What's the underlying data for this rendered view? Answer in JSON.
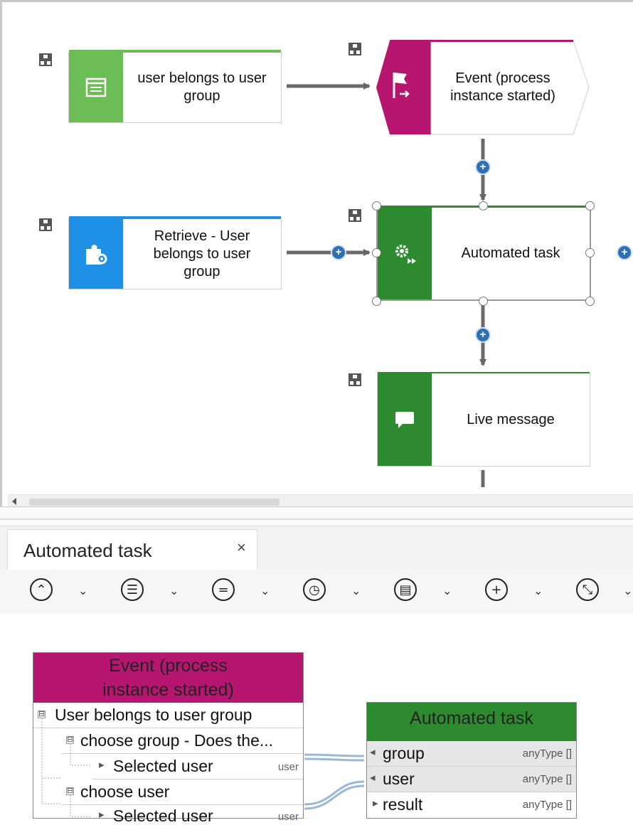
{
  "diagram": {
    "nodes": [
      {
        "id": "user-belongs",
        "label": "user belongs to user\ngroup",
        "band_color": "#6dbd57",
        "icon": "form-icon"
      },
      {
        "id": "event",
        "label": "Event (process\ninstance started)",
        "band_color": "#b6166f",
        "icon": "flag-event-icon"
      },
      {
        "id": "retrieve",
        "label": "Retrieve - User\nbelongs to user\ngroup",
        "band_color": "#1e90e6",
        "icon": "puzzle-gear-icon"
      },
      {
        "id": "automated",
        "label": "Automated task",
        "band_color": "#2e8a2e",
        "icon": "gear-play-icon"
      },
      {
        "id": "live",
        "label": "Live message",
        "band_color": "#2e8a2e",
        "icon": "speech-bubble-icon"
      }
    ],
    "plus_symbol": "+"
  },
  "panel": {
    "tab_title": "Automated task",
    "tab_close": "×",
    "toolbar": [
      {
        "icon": "caret-up-circle-icon",
        "glyph": "⌃"
      },
      {
        "icon": "list-circle-icon",
        "glyph": "☰"
      },
      {
        "icon": "equals-circle-icon",
        "glyph": "="
      },
      {
        "icon": "clock-circle-icon",
        "glyph": "◷"
      },
      {
        "icon": "document-circle-icon",
        "glyph": "▤"
      },
      {
        "icon": "crosshair-circle-icon",
        "glyph": "+"
      },
      {
        "icon": "arrows-circle-icon",
        "glyph": "⤡"
      }
    ],
    "chevron": "⌄"
  },
  "mapping": {
    "source": {
      "title": "Event (process\ninstance started)",
      "header_color": "#b6166f",
      "rows": [
        {
          "text": "User belongs to user group",
          "level": 0,
          "expander": "⊟"
        },
        {
          "text": "choose group - Does the...",
          "level": 1,
          "expander": "⊟"
        },
        {
          "text": "Selected user",
          "level": 2,
          "arrow": "▸",
          "tag": "user"
        },
        {
          "text": "choose user",
          "level": 1,
          "expander": "⊟"
        },
        {
          "text": "Selected user",
          "level": 2,
          "arrow": "▸",
          "tag": "user"
        }
      ]
    },
    "target": {
      "title": "Automated task",
      "header_color": "#2e8a2e",
      "rows": [
        {
          "text": "group",
          "type": "anyType []",
          "arrow": "◂"
        },
        {
          "text": "user",
          "type": "anyType []",
          "arrow": "◂"
        },
        {
          "text": "result",
          "type": "anyType []",
          "arrow": "▸"
        }
      ]
    }
  }
}
